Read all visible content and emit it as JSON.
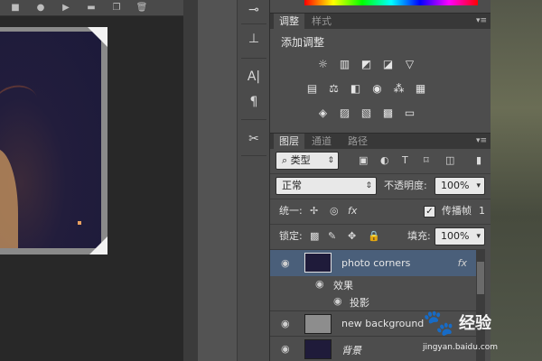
{
  "adjustments_panel": {
    "tabs": [
      "调整",
      "样式"
    ],
    "title": "添加调整"
  },
  "layers_panel": {
    "tabs": [
      "图层",
      "通道",
      "路径"
    ],
    "filter_label": "类型",
    "blend_mode": "正常",
    "opacity_label": "不透明度:",
    "opacity_value": "100%",
    "unify_label": "统一:",
    "propagate_label": "传播帧",
    "propagate_value": "1",
    "lock_label": "锁定:",
    "fill_label": "填充:",
    "fill_value": "100%",
    "layers": [
      {
        "name": "photo corners",
        "fx": "fx"
      },
      {
        "name": "效果"
      },
      {
        "name": "投影"
      },
      {
        "name": "new background"
      },
      {
        "name": "背景"
      }
    ]
  },
  "watermark": {
    "brand": "经验",
    "url": "jingyan.baidu.com"
  },
  "icons": {
    "actionbar": [
      "stop-icon",
      "record-icon",
      "play-icon",
      "folder-icon",
      "new-icon",
      "trash-icon"
    ],
    "dock": [
      "brush-preset-icon",
      "clone-source-icon",
      "character-icon",
      "paragraph-icon",
      "tool-presets-icon"
    ]
  },
  "colors": {
    "panel_bg": "#4d4d4d",
    "tab_bar": "#383838",
    "selected_layer": "#4a5f7a"
  }
}
